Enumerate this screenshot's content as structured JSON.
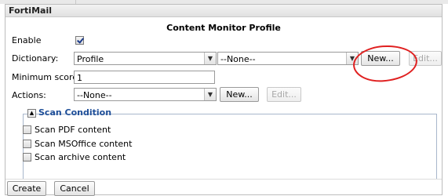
{
  "app": {
    "title": "FortiMail"
  },
  "profile": {
    "title": "Content Monitor Profile"
  },
  "form": {
    "enable": {
      "label": "Enable",
      "checked": true
    },
    "dictionary": {
      "label": "Dictionary:",
      "type_value": "Profile",
      "dictionary_value": "--None--",
      "new_label": "New...",
      "edit_label": "Edit..."
    },
    "min_score": {
      "label": "Minimum score:",
      "value": "1"
    },
    "actions": {
      "label": "Actions:",
      "value": "--None--",
      "new_label": "New...",
      "edit_label": "Edit..."
    }
  },
  "scan_condition": {
    "title": "Scan Condition",
    "toggle_glyph": "▲",
    "options": [
      {
        "label": "Scan PDF content",
        "checked": false
      },
      {
        "label": "Scan MSOffice content",
        "checked": false
      },
      {
        "label": "Scan archive content",
        "checked": false
      }
    ]
  },
  "footer": {
    "create_label": "Create",
    "cancel_label": "Cancel"
  },
  "icons": {
    "dropdown_arrow": "▼"
  },
  "colors": {
    "annotation": "#e02020",
    "section_title": "#1f4f99"
  }
}
